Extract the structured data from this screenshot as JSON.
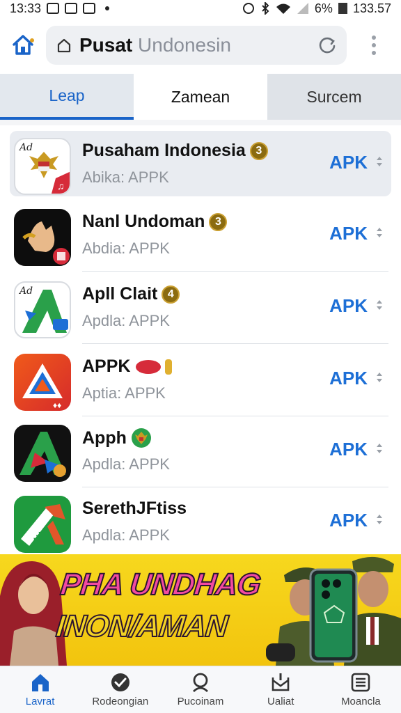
{
  "status_bar": {
    "time": "13:33",
    "battery": "6%",
    "right_text": "133.57"
  },
  "address_bar": {
    "host": "Pusat",
    "rest": "Undonesin"
  },
  "tabs": [
    {
      "label": "Leap",
      "active": true
    },
    {
      "label": "Zamean",
      "active": false
    },
    {
      "label": "Surcem",
      "active": false
    }
  ],
  "apps": [
    {
      "name": "Pusaham Indonesia",
      "badge": "3",
      "subtitle": "Abika: APPK",
      "action": "APK",
      "icon": "garuda-emblem-icon"
    },
    {
      "name": "Nanl Undoman",
      "badge": "3",
      "subtitle": "Abdia: APPK",
      "action": "APK",
      "icon": "hand-icon"
    },
    {
      "name": "Apll Clait",
      "badge": "4",
      "subtitle": "Apdla: APPK",
      "action": "APK",
      "icon": "green-a-icon"
    },
    {
      "name": "APPK",
      "badge": "",
      "subtitle": "Aptia: APPK",
      "action": "APK",
      "icon": "red-triangle-icon"
    },
    {
      "name": "Apph",
      "badge": "",
      "subtitle": "Apdla: APPK",
      "action": "APK",
      "icon": "dark-a-icon"
    },
    {
      "name": "SerethJFtiss",
      "badge": "",
      "subtitle": "Apdla: APPK",
      "action": "APK",
      "icon": "green-diagonal-icon"
    }
  ],
  "banner": {
    "line1": "PHA UNDHAG",
    "line2": "INON/AMAN"
  },
  "bottom_nav": [
    {
      "label": "Lavrat",
      "icon": "home-icon",
      "active": true
    },
    {
      "label": "Rodeongian",
      "icon": "check-circle-icon",
      "active": false
    },
    {
      "label": "Pucoinam",
      "icon": "search-icon",
      "active": false
    },
    {
      "label": "Ualiat",
      "icon": "inbox-icon",
      "active": false
    },
    {
      "label": "Moancla",
      "icon": "list-icon",
      "active": false
    }
  ],
  "colors": {
    "accent": "#1a64c8",
    "apk": "#1d6fd6",
    "banner": "#f4cc14"
  }
}
